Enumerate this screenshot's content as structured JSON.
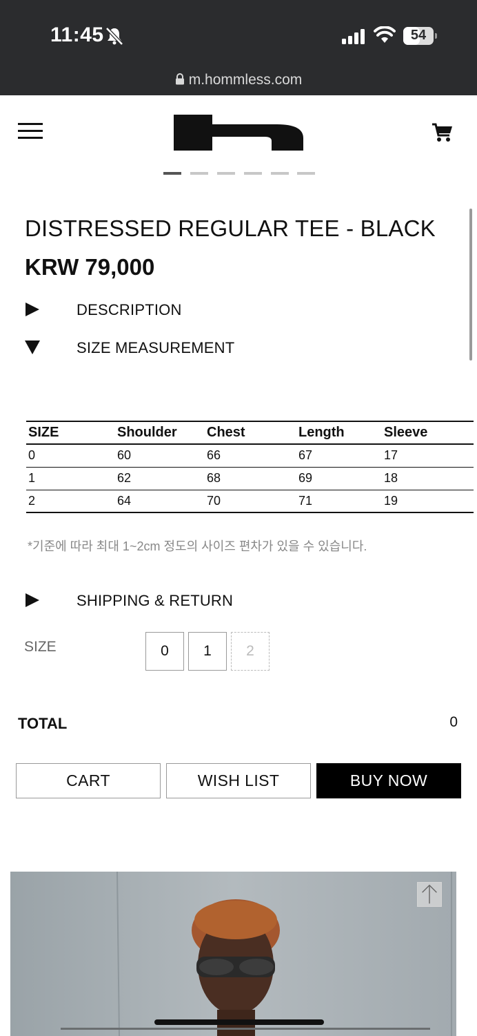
{
  "status_bar": {
    "time": "11:45",
    "battery": "54",
    "battery_level": 0.54,
    "url": "m.hommless.com"
  },
  "header": {
    "menu_icon": "hamburger-icon",
    "logo_icon": "hommless-logo",
    "cart_icon": "shopping-cart-icon"
  },
  "carousel": {
    "total_dots": 6,
    "active_index": 0
  },
  "product": {
    "title": "DISTRESSED REGULAR TEE - BLACK",
    "price": "KRW 79,000"
  },
  "sections": {
    "description": "DESCRIPTION",
    "size_measurement": "SIZE MEASUREMENT",
    "shipping": "SHIPPING & RETURN"
  },
  "size_table": {
    "headers": [
      "SIZE",
      "Shoulder",
      "Chest",
      "Length",
      "Sleeve"
    ],
    "rows": [
      [
        "0",
        "60",
        "66",
        "67",
        "17"
      ],
      [
        "1",
        "62",
        "68",
        "69",
        "18"
      ],
      [
        "2",
        "64",
        "70",
        "71",
        "19"
      ]
    ],
    "note": "*기준에 따라 최대 1~2cm 정도의 사이즈 편차가 있을 수 있습니다."
  },
  "size_selector": {
    "label": "SIZE",
    "options": [
      "0",
      "1",
      "2"
    ],
    "sold_out": [
      "2"
    ]
  },
  "total": {
    "label": "TOTAL",
    "value": "0"
  },
  "actions": {
    "cart": "CART",
    "wishlist": "WISH LIST",
    "buy_now": "BUY NOW"
  },
  "colors": {
    "status_bar_bg": "#2b2c2e",
    "text": "#111111",
    "buy_now_bg": "#000000",
    "muted": "#888888"
  }
}
